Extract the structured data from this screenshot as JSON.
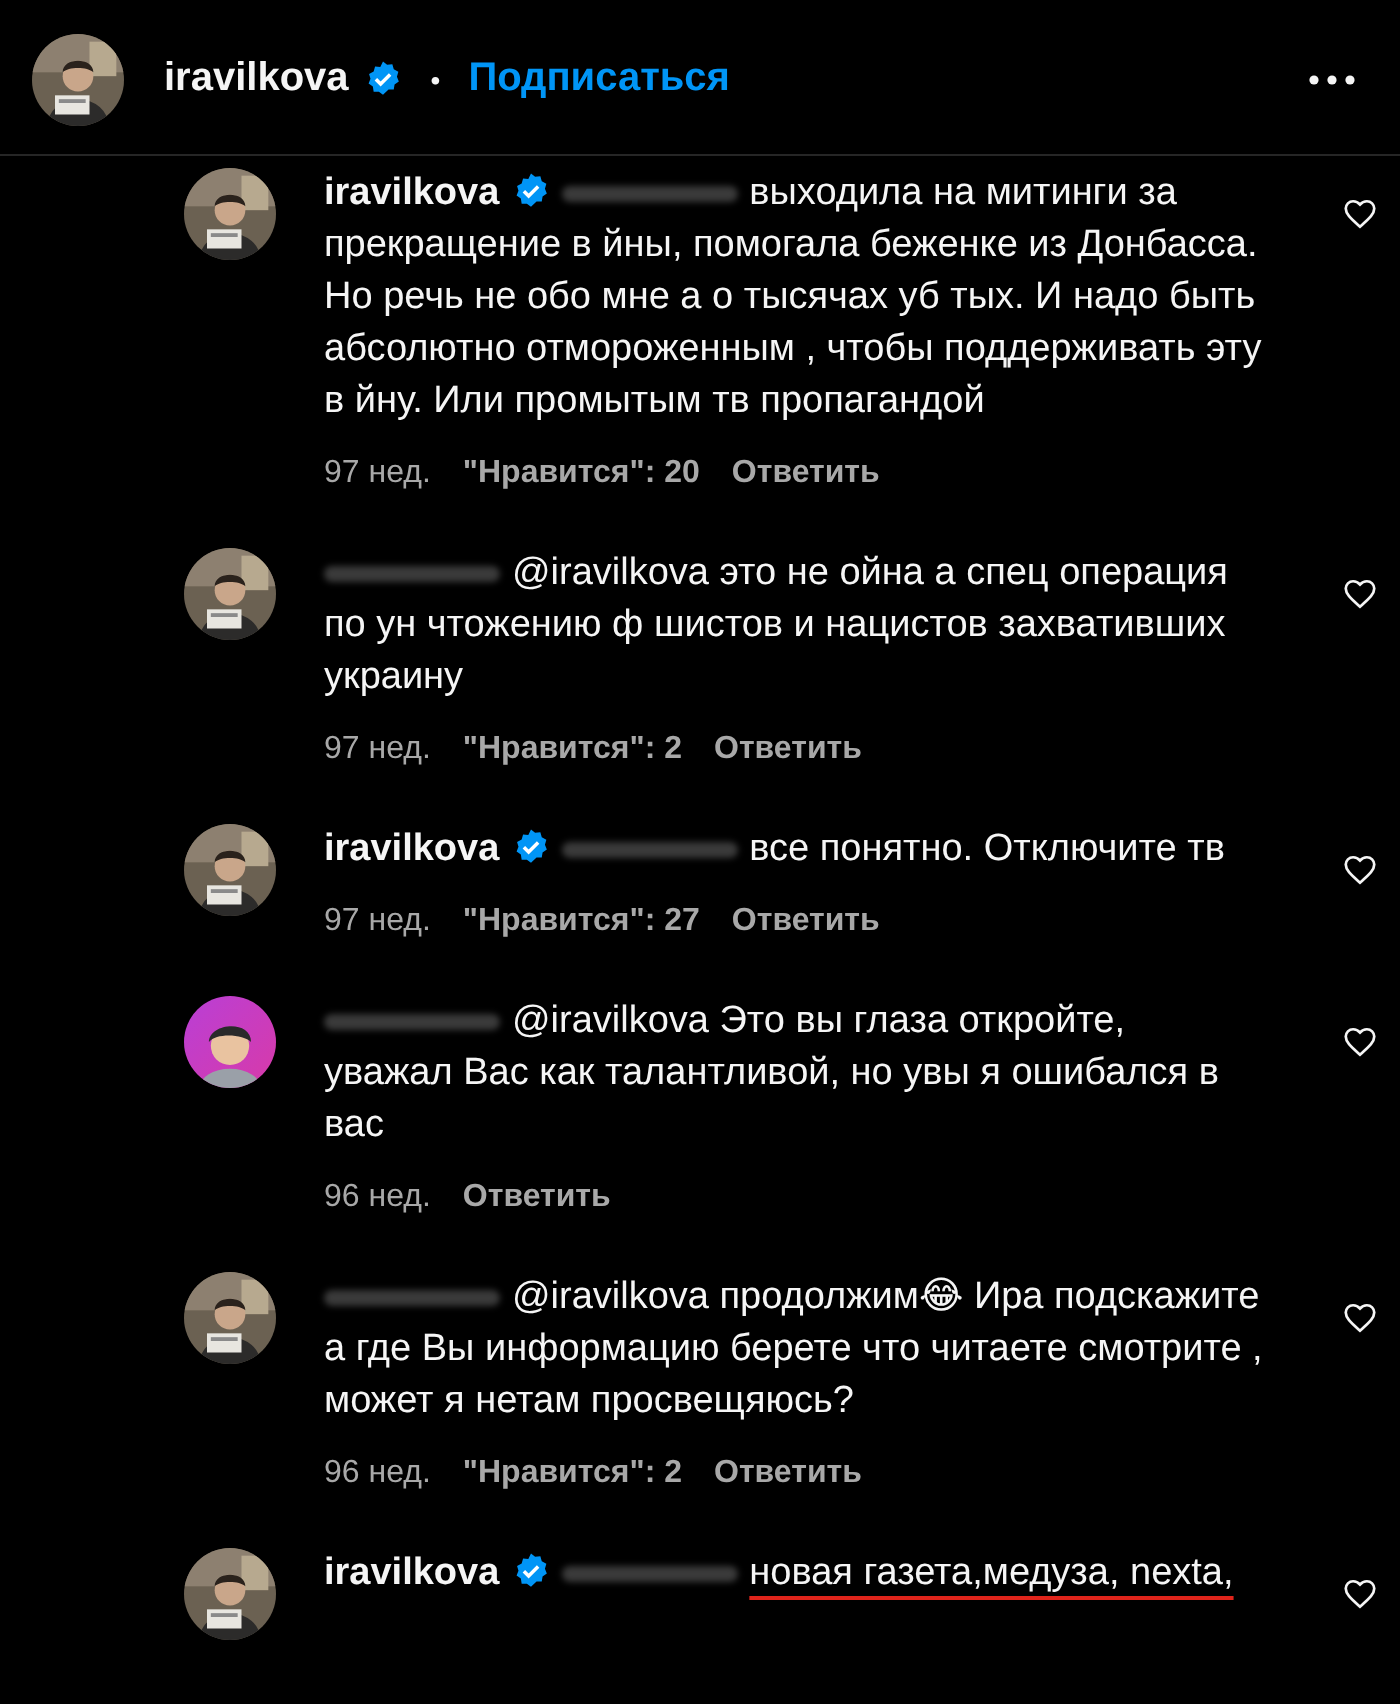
{
  "header": {
    "username": "iravilkova",
    "verified": true,
    "separator": "•",
    "follow": "Подписаться"
  },
  "comments": [
    {
      "author": "iravilkova",
      "author_hidden": false,
      "verified": true,
      "mention_hidden": true,
      "text": "выходила на митинги за прекращение в йны, помогала беженке из Донбасса. Но речь не обо мне а о тысячах уб тых. И надо быть абсолютно отмороженным , чтобы поддерживать эту в йну. Или промытым тв пропагандой",
      "underlined": false,
      "time": "97 нед.",
      "likes": "\"Нравится\": 20",
      "reply": "Ответить"
    },
    {
      "author_hidden": true,
      "verified": false,
      "mention_hidden": false,
      "text": "@iravilkova это не ойна а спец операция по ун чтожению ф шистов и нацистов захвативших украину",
      "underlined": false,
      "time": "97 нед.",
      "likes": "\"Нравится\": 2",
      "reply": "Ответить"
    },
    {
      "author": "iravilkova",
      "author_hidden": false,
      "verified": true,
      "mention_hidden": true,
      "text": "все понятно. Отключите тв",
      "underlined": false,
      "time": "97 нед.",
      "likes": "\"Нравится\": 27",
      "reply": "Ответить"
    },
    {
      "author_hidden": true,
      "verified": false,
      "mention_hidden": false,
      "kind": "cartoon",
      "text": "@iravilkova Это вы глаза откройте, уважал Вас как талантливой, но увы я ошибался в вас",
      "underlined": false,
      "time": "96 нед.",
      "reply": "Ответить"
    },
    {
      "author_hidden": true,
      "verified": false,
      "mention_hidden": false,
      "text": "@iravilkova продолжим😂 Ира подскажите а где Вы информацию берете что читаете смотрите , может я нетам просвещяюсь?",
      "underlined": false,
      "time": "96 нед.",
      "likes": "\"Нравится\": 2",
      "reply": "Ответить"
    },
    {
      "author": "iravilkova",
      "author_hidden": false,
      "verified": true,
      "mention_hidden": true,
      "text": "новая газета,медуза, nexta,",
      "underlined": true
    }
  ]
}
